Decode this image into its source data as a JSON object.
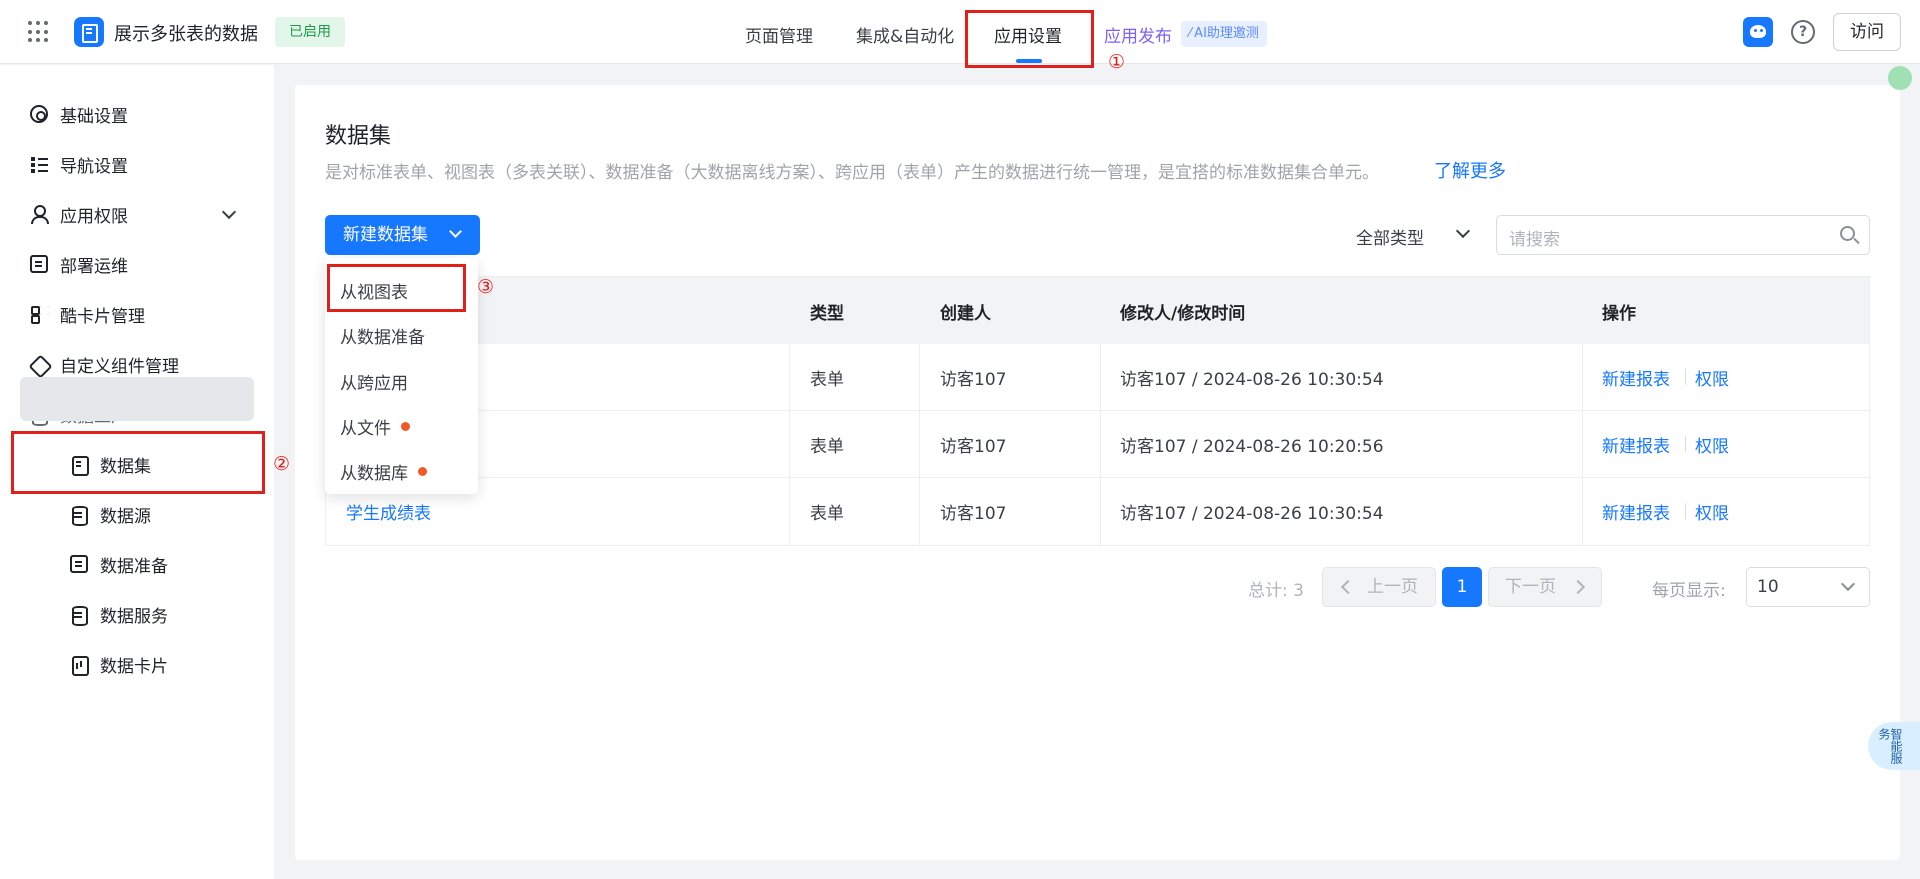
{
  "header": {
    "app_title": "展示多张表的数据",
    "status": "已启用",
    "tabs": [
      "页面管理",
      "集成&自动化",
      "应用设置"
    ],
    "publish_tab": "应用发布",
    "ai_badge": "AI助理邀测",
    "visit_label": "访问"
  },
  "annotations": {
    "one": "①",
    "two": "②",
    "three": "③"
  },
  "sidebar": {
    "items": [
      "基础设置",
      "导航设置",
      "应用权限",
      "部署运维",
      "酷卡片管理",
      "自定义组件管理",
      "数据工厂"
    ],
    "sub_items": [
      "数据集",
      "数据源",
      "数据准备",
      "数据服务",
      "数据卡片"
    ]
  },
  "main": {
    "title": "数据集",
    "description": "是对标准表单、视图表（多表关联）、数据准备（大数据离线方案）、跨应用（表单）产生的数据进行统一管理，是宜搭的标准数据集合单元。",
    "learn_more": "了解更多",
    "new_button": "新建数据集",
    "type_filter": "全部类型",
    "search_placeholder": "请搜索"
  },
  "dropdown": [
    "从视图表",
    "从数据准备",
    "从跨应用",
    "从文件",
    "从数据库"
  ],
  "table": {
    "columns": [
      "类型",
      "创建人",
      "修改人/修改时间",
      "操作"
    ],
    "rows": [
      {
        "name": "",
        "type": "表单",
        "creator": "访客107",
        "modified": "访客107 / 2024-08-26 10:30:54",
        "action1": "新建报表",
        "action2": "权限"
      },
      {
        "name": "",
        "type": "表单",
        "creator": "访客107",
        "modified": "访客107 / 2024-08-26 10:20:56",
        "action1": "新建报表",
        "action2": "权限"
      },
      {
        "name": "学生成绩表",
        "type": "表单",
        "creator": "访客107",
        "modified": "访客107 / 2024-08-26 10:30:54",
        "action1": "新建报表",
        "action2": "权限"
      }
    ]
  },
  "pagination": {
    "total": "总计: 3",
    "prev": "上一页",
    "current": "1",
    "next": "下一页",
    "page_size_label": "每页显示:",
    "page_size": "10"
  },
  "feedback": "智能服务"
}
